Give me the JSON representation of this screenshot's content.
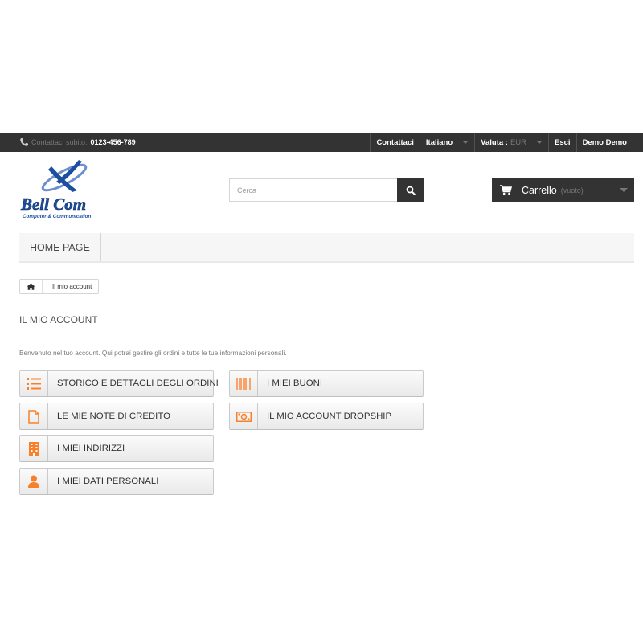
{
  "topbar": {
    "contact_label": "Contattaci subito:",
    "phone": "0123-456-789",
    "nav": {
      "contact": "Contattaci",
      "language": "Italiano",
      "currency_label": "Valuta :",
      "currency_value": "EUR",
      "logout": "Esci",
      "user": "Demo Demo"
    }
  },
  "logo": {
    "line1": "Bell Com",
    "line2": "Computer & Communication"
  },
  "search": {
    "placeholder": "Cerca"
  },
  "cart": {
    "title": "Carrello",
    "status": "(vuoto)"
  },
  "menu": {
    "items": [
      {
        "label": "HOME PAGE"
      }
    ]
  },
  "breadcrumb": {
    "current": "Il mio account"
  },
  "page": {
    "heading": "IL MIO ACCOUNT",
    "intro": "Benvenuto nel tuo account. Qui potrai gestire gli ordini e tutte le tue informazioni personali."
  },
  "account_links": [
    {
      "label": "STORICO E DETTAGLI DEGLI ORDINI",
      "icon": "list-icon"
    },
    {
      "label": "LE MIE NOTE DI CREDITO",
      "icon": "document-icon"
    },
    {
      "label": "I MIEI INDIRIZZI",
      "icon": "building-icon"
    },
    {
      "label": "I MIEI DATI PERSONALI",
      "icon": "user-icon"
    },
    {
      "label": "I MIEI BUONI",
      "icon": "barcode-icon"
    },
    {
      "label": "IL MIO ACCOUNT DROPSHIP",
      "icon": "money-icon"
    }
  ],
  "colors": {
    "accent": "#f7812a",
    "dark_bar": "#333333",
    "logo_blue": "#1c4fa0"
  }
}
